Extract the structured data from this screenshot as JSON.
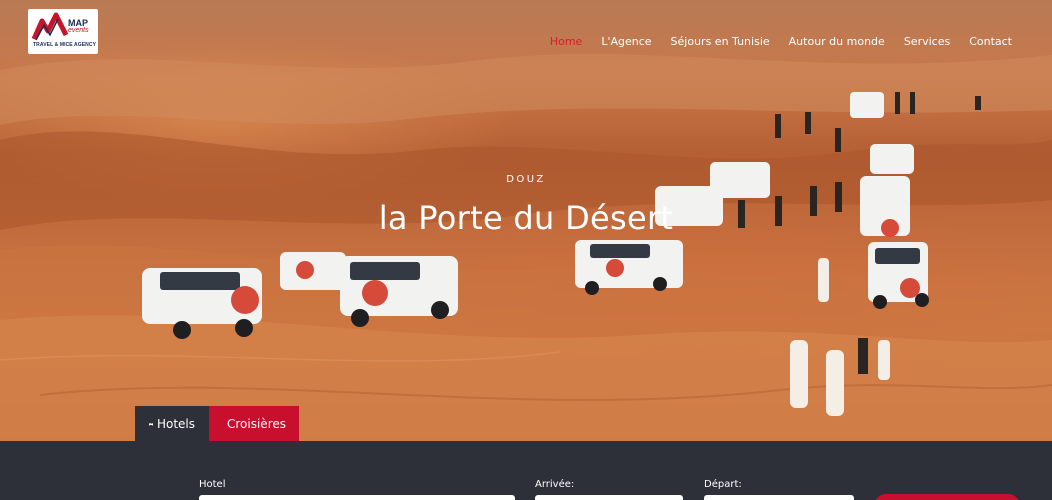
{
  "brand": {
    "name": "MAP",
    "sub": "events",
    "tagline": "TRAVEL & MICE AGENCY",
    "accent": "#c8102e",
    "navy": "#1b2a55"
  },
  "nav": {
    "items": [
      {
        "label": "Home",
        "active": true
      },
      {
        "label": "L'Agence",
        "active": false
      },
      {
        "label": "Séjours en Tunisie",
        "active": false
      },
      {
        "label": "Autour du monde",
        "active": false
      },
      {
        "label": "Services",
        "active": false
      },
      {
        "label": "Contact",
        "active": false
      }
    ],
    "active_color": "#d6202e"
  },
  "hero": {
    "eyebrow": "DOUZ",
    "title": "la Porte du Désert"
  },
  "tabs": [
    {
      "label": "Hotels",
      "icon": "bed-icon",
      "active": true
    },
    {
      "label": "Croisières",
      "icon": "ship-icon",
      "active": false
    }
  ],
  "search": {
    "hotel_label": "Hotel",
    "arrival_label": "Arrivée:",
    "departure_label": "Départ:"
  }
}
